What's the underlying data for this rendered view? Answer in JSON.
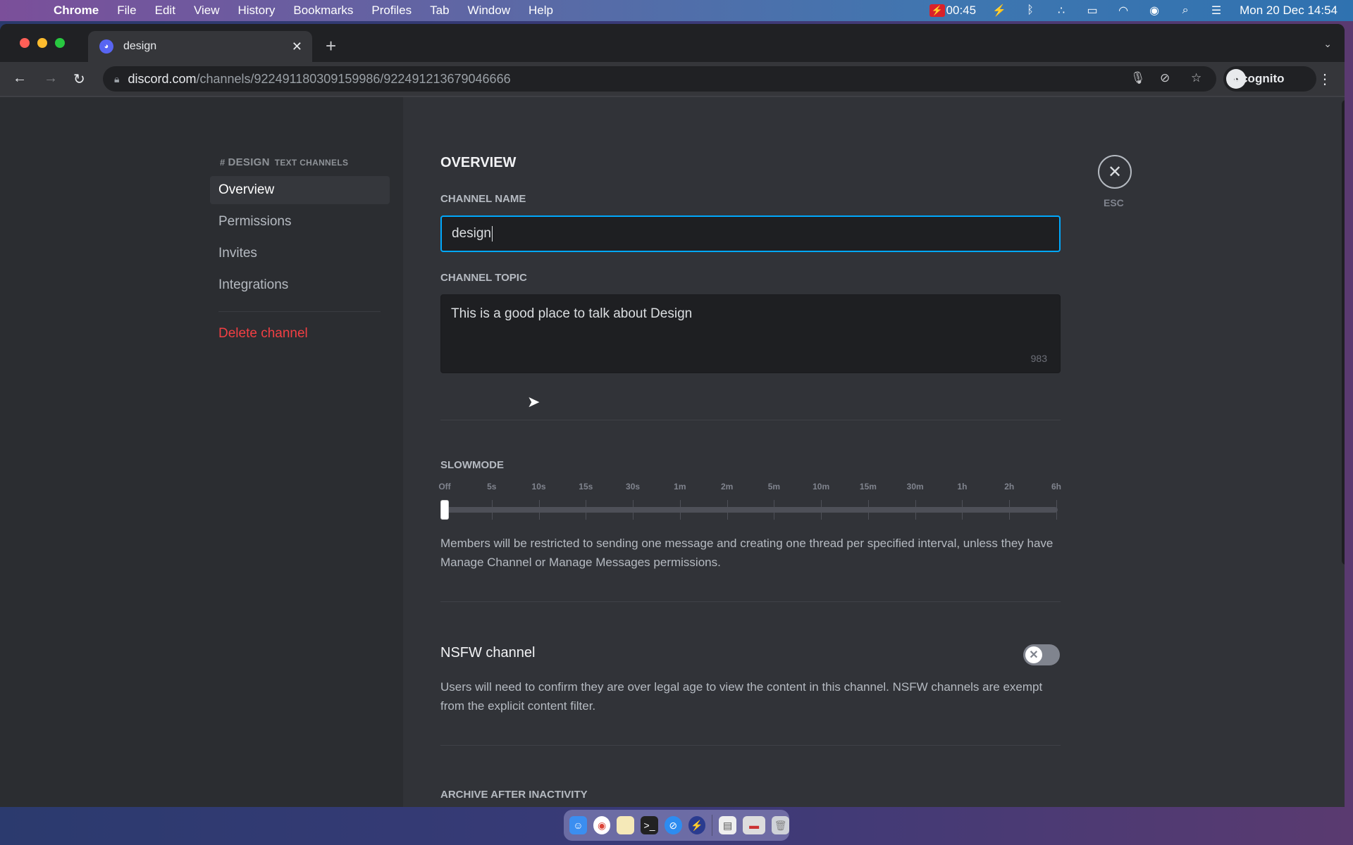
{
  "menubar": {
    "app_name": "Chrome",
    "items": [
      "File",
      "Edit",
      "View",
      "History",
      "Bookmarks",
      "Profiles",
      "Tab",
      "Window",
      "Help"
    ],
    "status": {
      "recording_time": "00:45",
      "datetime": "Mon 20 Dec  14:54"
    }
  },
  "browser": {
    "tab": {
      "title": "design",
      "close_label": "✕"
    },
    "new_tab_label": "+",
    "url_host": "discord.com",
    "url_path": "/channels/922491180309159986/922491213679046666",
    "profile_label": "Incognito"
  },
  "settings": {
    "sidebar": {
      "channel_prefix": "#",
      "channel_name": "DESIGN",
      "category": "TEXT CHANNELS",
      "items": [
        {
          "label": "Overview",
          "active": true
        },
        {
          "label": "Permissions",
          "active": false
        },
        {
          "label": "Invites",
          "active": false
        },
        {
          "label": "Integrations",
          "active": false
        }
      ],
      "delete_label": "Delete channel"
    },
    "overview": {
      "title": "OVERVIEW",
      "channel_name_label": "CHANNEL NAME",
      "channel_name_value": "design",
      "channel_topic_label": "CHANNEL TOPIC",
      "channel_topic_value": "This is a good place to talk about Design",
      "topic_chars_remaining": "983",
      "slowmode": {
        "label": "SLOWMODE",
        "options": [
          "Off",
          "5s",
          "10s",
          "15s",
          "30s",
          "1m",
          "2m",
          "5m",
          "10m",
          "15m",
          "30m",
          "1h",
          "2h",
          "6h"
        ],
        "selected_index": 0,
        "description": "Members will be restricted to sending one message and creating one thread per specified interval, unless they have Manage Channel or Manage Messages permissions."
      },
      "nsfw": {
        "title": "NSFW channel",
        "enabled": false,
        "description": "Users will need to confirm they are over legal age to view the content in this channel. NSFW channels are exempt from the explicit content filter."
      },
      "archive_label": "ARCHIVE AFTER INACTIVITY"
    },
    "close_label": "✕",
    "esc_label": "ESC"
  },
  "colors": {
    "accent_focus": "#00a8fc",
    "danger": "#f23f43",
    "discord_blurple": "#5865f2"
  }
}
